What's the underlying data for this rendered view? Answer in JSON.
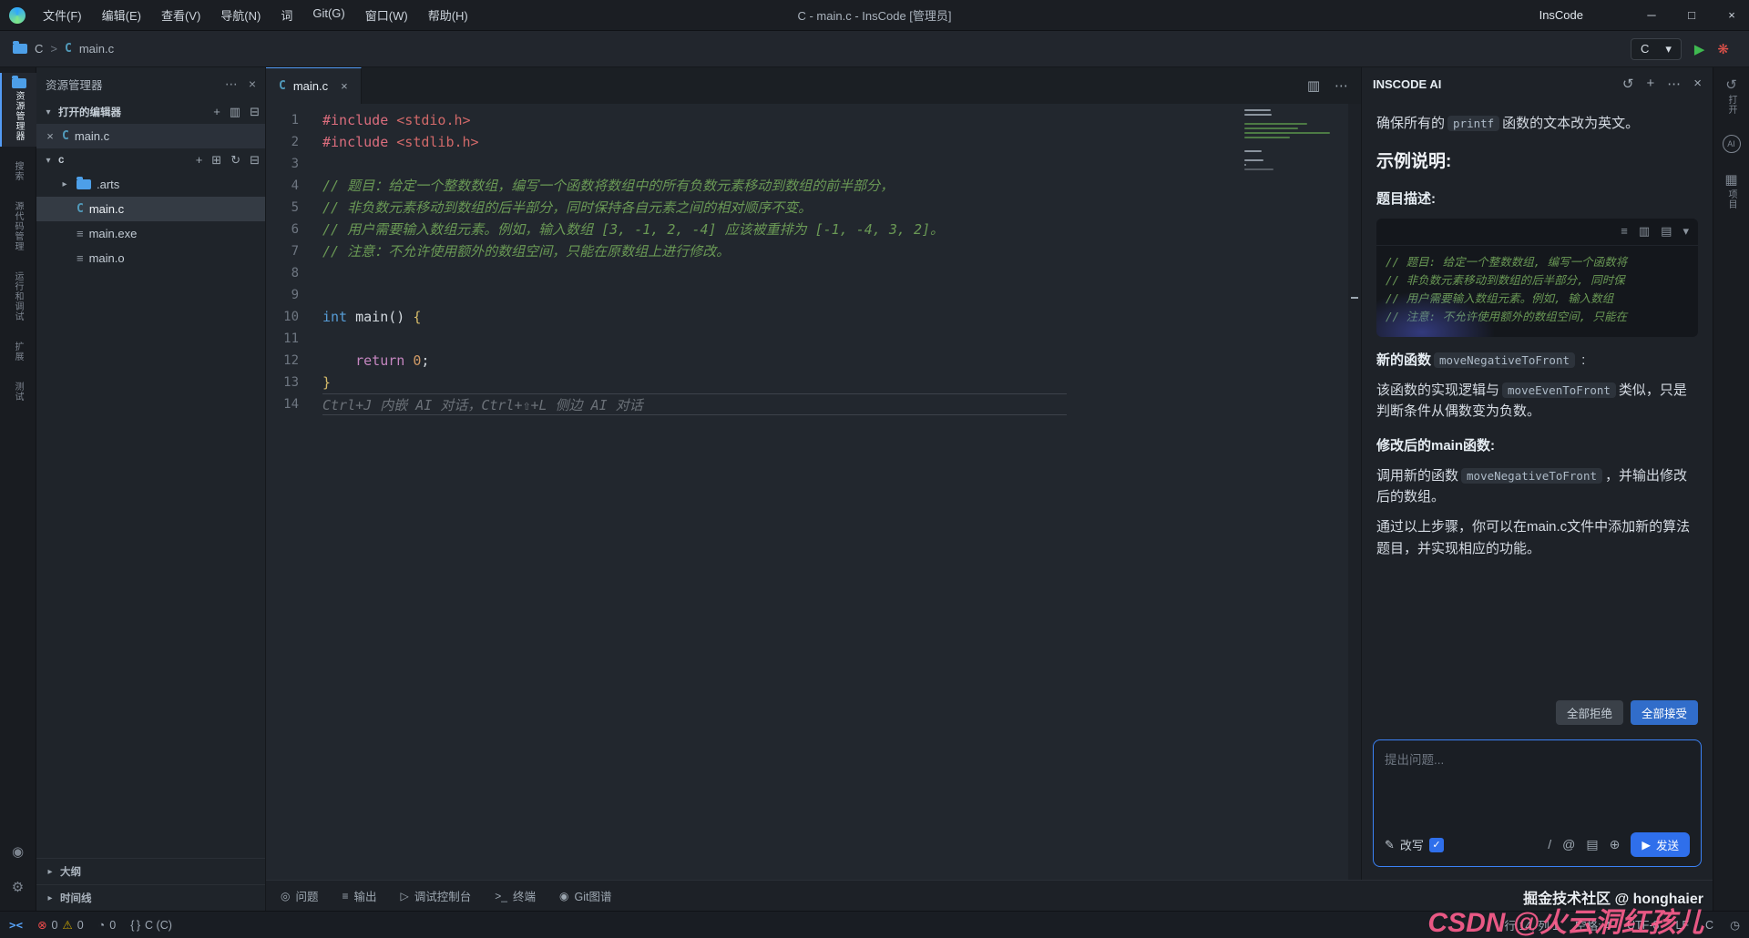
{
  "colors": {
    "accent": "#3794ff",
    "error": "#f14c4c",
    "warning": "#cca700",
    "run_green": "#3fb950",
    "watermark_pink": "#ff5f8f"
  },
  "titlebar": {
    "menus": [
      "文件(F)",
      "编辑(E)",
      "查看(V)",
      "导航(N)",
      "词",
      "Git(G)",
      "窗口(W)",
      "帮助(H)"
    ],
    "window_title": "C - main.c - InsCode [管理员]",
    "brand": "InsCode",
    "controls": {
      "minimize": "─",
      "maximize": "□",
      "close": "×"
    }
  },
  "toolbar": {
    "breadcrumb_root": "C",
    "breadcrumb_sep": ">",
    "breadcrumb_file": "main.c",
    "run_target": "C",
    "run_caret": "▾"
  },
  "activity_left": {
    "items": [
      {
        "label": "资源管理器",
        "folder": true,
        "active": true
      },
      {
        "label": "搜索"
      },
      {
        "label": "源代码管理"
      },
      {
        "label": "运行和调试"
      },
      {
        "label": "扩展"
      },
      {
        "label": "测试"
      }
    ],
    "bottom_items": [
      {
        "label": "账户",
        "icon": "◉"
      },
      {
        "label": "管理",
        "icon": "⚙"
      }
    ]
  },
  "activity_right": {
    "items": [
      {
        "label": "打开",
        "icon": "↺"
      },
      {
        "label": "",
        "icon": "AI",
        "badge": true
      },
      {
        "label": "项目",
        "icon": "▦"
      }
    ]
  },
  "explorer": {
    "title": "资源管理器",
    "title_icons": [
      "⋯",
      "×"
    ],
    "open_editors": {
      "label": "打开的编辑器",
      "icons": [
        "+",
        "▥",
        "⊟"
      ],
      "items": [
        {
          "name": "main.c",
          "icon": "c"
        }
      ]
    },
    "folder": {
      "label": "c",
      "icons": [
        "+",
        "⊞",
        "↻",
        "⊟"
      ],
      "items": [
        {
          "name": ".arts",
          "icon": "folder",
          "chevron": true
        },
        {
          "name": "main.c",
          "icon": "c",
          "selected": true
        },
        {
          "name": "main.exe",
          "icon": "bin"
        },
        {
          "name": "main.o",
          "icon": "bin"
        }
      ]
    },
    "outline": "大纲",
    "timeline": "时间线"
  },
  "editor": {
    "tab": "main.c",
    "tab_close": "×",
    "group_icons": [
      "▥",
      "⋯"
    ],
    "lines": [
      {
        "n": 1,
        "segs": [
          {
            "c": "directive",
            "t": "#include"
          },
          {
            "c": "plain",
            "t": " "
          },
          {
            "c": "string",
            "t": "<stdio.h>"
          }
        ]
      },
      {
        "n": 2,
        "segs": [
          {
            "c": "directive",
            "t": "#include"
          },
          {
            "c": "plain",
            "t": " "
          },
          {
            "c": "string",
            "t": "<stdlib.h>"
          }
        ]
      },
      {
        "n": 3,
        "segs": []
      },
      {
        "n": 4,
        "segs": [
          {
            "c": "comment",
            "t": "// 题目：给定一个整数数组，编写一个函数将数组中的所有负数元素移动到数组的前半部分，"
          }
        ]
      },
      {
        "n": 5,
        "segs": [
          {
            "c": "comment",
            "t": "// 非负数元素移动到数组的后半部分，同时保持各自元素之间的相对顺序不变。"
          }
        ]
      },
      {
        "n": 6,
        "segs": [
          {
            "c": "comment",
            "t": "// 用户需要输入数组元素。例如，输入数组 [3, -1, 2, -4] 应该被重排为 [-1, -4, 3, 2]。"
          }
        ]
      },
      {
        "n": 7,
        "segs": [
          {
            "c": "comment",
            "t": "// 注意：不允许使用额外的数组空间，只能在原数组上进行修改。"
          }
        ]
      },
      {
        "n": 8,
        "segs": []
      },
      {
        "n": 9,
        "segs": []
      },
      {
        "n": 10,
        "segs": [
          {
            "c": "type",
            "t": "int"
          },
          {
            "c": "plain",
            "t": " main"
          },
          {
            "c": "plain",
            "t": "()"
          },
          {
            "c": "brace",
            "t": " {"
          }
        ]
      },
      {
        "n": 11,
        "segs": []
      },
      {
        "n": 12,
        "segs": [
          {
            "c": "plain",
            "t": "    "
          },
          {
            "c": "keyword",
            "t": "return"
          },
          {
            "c": "plain",
            "t": " "
          },
          {
            "c": "number",
            "t": "0"
          },
          {
            "c": "plain",
            "t": ";"
          }
        ]
      },
      {
        "n": 13,
        "segs": [
          {
            "c": "brace",
            "t": "}"
          }
        ]
      },
      {
        "n": 14,
        "ghost": "Ctrl+J 内嵌 AI 对话，Ctrl+⇧+L 侧边 AI 对话"
      }
    ]
  },
  "ai_panel": {
    "title": "INSCODE AI",
    "header_icons": [
      "↺",
      "+",
      "⋯",
      "×"
    ],
    "code_icons": [
      {
        "name": "diff-icon",
        "glyph": "≡"
      },
      {
        "name": "copy-icon",
        "glyph": "▥"
      },
      {
        "name": "insert-icon",
        "glyph": "▤"
      },
      {
        "name": "collapse-icon",
        "glyph": "▾"
      }
    ],
    "blocks": [
      {
        "type": "p",
        "parts": [
          {
            "t": "确保所有的"
          },
          {
            "t": "printf",
            "code": true
          },
          {
            "t": "函数的文本改为英文。"
          }
        ]
      },
      {
        "type": "h2",
        "text": "示例说明:"
      },
      {
        "type": "h3",
        "text": "题目描述:"
      },
      {
        "type": "code",
        "lines": [
          "// 题目: 给定一个整数数组, 编写一个函数将",
          "// 非负数元素移动到数组的后半部分, 同时保",
          "// 用户需要输入数组元素。例如, 输入数组",
          "// 注意: 不允许使用额外的数组空间, 只能在"
        ]
      },
      {
        "type": "p",
        "parts": [
          {
            "t": "新的函数",
            "bold": true
          },
          {
            "t": "moveNegativeToFront",
            "code": true
          },
          {
            "t": " :"
          }
        ]
      },
      {
        "type": "p",
        "parts": [
          {
            "t": "该函数的实现逻辑与"
          },
          {
            "t": "moveEvenToFront",
            "code": true
          },
          {
            "t": "类似，只是判断条件从偶数变为负数。"
          }
        ]
      },
      {
        "type": "h3",
        "text": "修改后的main函数:"
      },
      {
        "type": "p",
        "parts": [
          {
            "t": "调用新的函数"
          },
          {
            "t": "moveNegativeToFront",
            "code": true
          },
          {
            "t": "，并输出修改后的数组。"
          }
        ]
      },
      {
        "type": "p",
        "parts": [
          {
            "t": "通过以上步骤，你可以在main.c文件中添加新的算法题目，并实现相应的功能。"
          }
        ]
      }
    ],
    "reject_label": "全部拒绝",
    "accept_label": "全部接受",
    "input_placeholder": "提出问题...",
    "rewrite_label": "改写",
    "checkbox_mark": "✓",
    "input_icons": [
      {
        "name": "slash-command-icon",
        "glyph": "/"
      },
      {
        "name": "mention-icon",
        "glyph": "@"
      },
      {
        "name": "library-icon",
        "glyph": "▤"
      },
      {
        "name": "attach-icon",
        "glyph": "⊕"
      }
    ],
    "send_label": "发送",
    "send_icon": "▶"
  },
  "panel_tabs": [
    {
      "icon": "◎",
      "label": "问题"
    },
    {
      "icon": "≡",
      "label": "输出"
    },
    {
      "icon": "▷",
      "label": "调试控制台"
    },
    {
      "icon": ">_",
      "label": "终端"
    },
    {
      "icon": "◉",
      "label": "Git图谱"
    }
  ],
  "statusbar": {
    "remote": "><",
    "errors": "0",
    "warnings": "0",
    "ports": "0",
    "lang_status": "C (C)",
    "right": [
      "行 14, 列 1",
      "空格: 4",
      "UTF-8",
      "LF",
      "C"
    ]
  },
  "watermarks": {
    "juejin": "掘金技术社区 @ honghaier",
    "csdn": "CSDN @火云洞红孩儿"
  }
}
